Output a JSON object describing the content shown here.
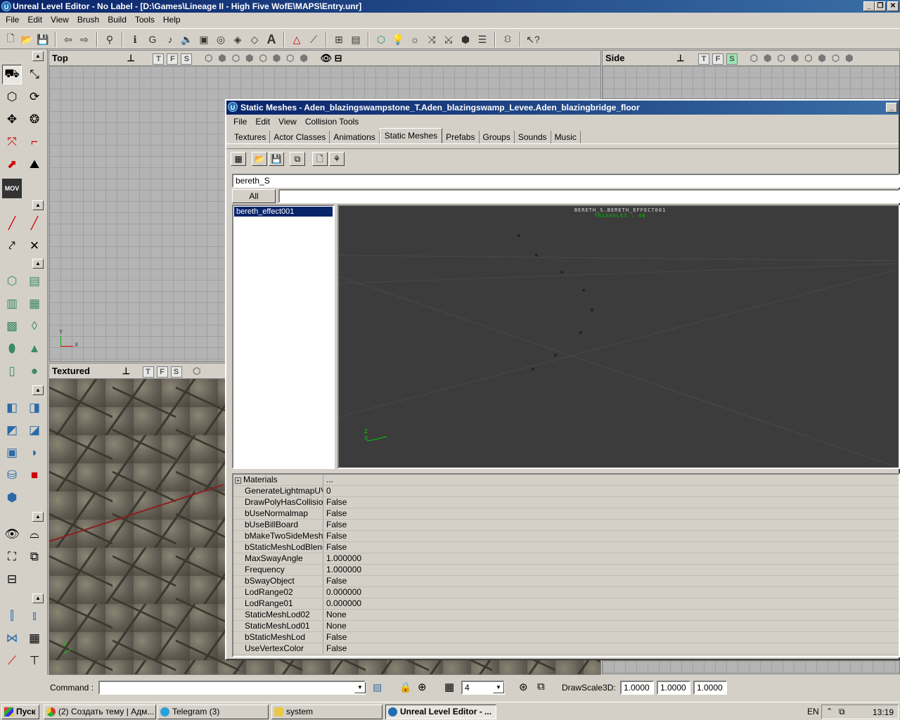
{
  "window": {
    "title": "Unreal Level Editor - No Label - [D:\\Games\\Lineage II - High Five WofE\\MAPS\\Entry.unr]"
  },
  "menu": [
    "File",
    "Edit",
    "View",
    "Brush",
    "Build",
    "Tools",
    "Help"
  ],
  "viewports": {
    "top": "Top",
    "side": "Side",
    "textured": "Textured",
    "tfs": [
      "T",
      "F",
      "S"
    ]
  },
  "browser": {
    "title": "Static Meshes - Aden_blazingswampstone_T.Aden_blazingswamp_Levee.Aden_blazingbridge_floor",
    "menu": [
      "File",
      "Edit",
      "View",
      "Collision Tools"
    ],
    "tabs": [
      "Textures",
      "Actor Classes",
      "Animations",
      "Static Meshes",
      "Prefabs",
      "Groups",
      "Sounds",
      "Music"
    ],
    "active_tab": "Static Meshes",
    "package": "bereth_S",
    "group_button": "All",
    "group_value": "",
    "items": [
      "bereth_effect001"
    ],
    "selected_item": "bereth_effect001",
    "preview_name": "BERETH_S.BERETH_EFFECT001",
    "preview_tris": "TRIANGLES : 48",
    "props_group": "Materials",
    "props_group_value": "...",
    "properties": [
      {
        "name": "GenerateLightmapUV...",
        "value": "0"
      },
      {
        "name": "DrawPolyHasCollision...",
        "value": "False"
      },
      {
        "name": "bUseNormalmap",
        "value": "False"
      },
      {
        "name": "bUseBillBoard",
        "value": "False"
      },
      {
        "name": "bMakeTwoSideMesh",
        "value": "False"
      },
      {
        "name": "bStaticMeshLodBlend",
        "value": "False"
      },
      {
        "name": "MaxSwayAngle",
        "value": "1.000000"
      },
      {
        "name": "Frequency",
        "value": "1.000000"
      },
      {
        "name": "bSwayObject",
        "value": "False"
      },
      {
        "name": "LodRange02",
        "value": "0.000000"
      },
      {
        "name": "LodRange01",
        "value": "0.000000"
      },
      {
        "name": "StaticMeshLod02",
        "value": "None"
      },
      {
        "name": "StaticMeshLod01",
        "value": "None"
      },
      {
        "name": "bStaticMeshLod",
        "value": "False"
      },
      {
        "name": "UseVertexColor",
        "value": "False"
      }
    ]
  },
  "command": {
    "label": "Command :",
    "value": "",
    "grid_value": "4",
    "drawscale_label": "DrawScale3D:",
    "scale": [
      "1.0000",
      "1.0000",
      "1.0000"
    ]
  },
  "taskbar": {
    "start": "Пуск",
    "tasks": [
      "(2) Создать тему | Адм...",
      "Telegram (3)",
      "system",
      "Unreal Level Editor - ..."
    ],
    "lang": "EN",
    "clock": "13:19"
  },
  "colors": {
    "title": "#0a246a",
    "preview_bg": "#3c3c3c",
    "tris_text": "#00c000",
    "selected": "#0a246a"
  },
  "axis_labels": {
    "z": "Z",
    "x": "X",
    "y": "Y"
  },
  "left_label": "MOV"
}
